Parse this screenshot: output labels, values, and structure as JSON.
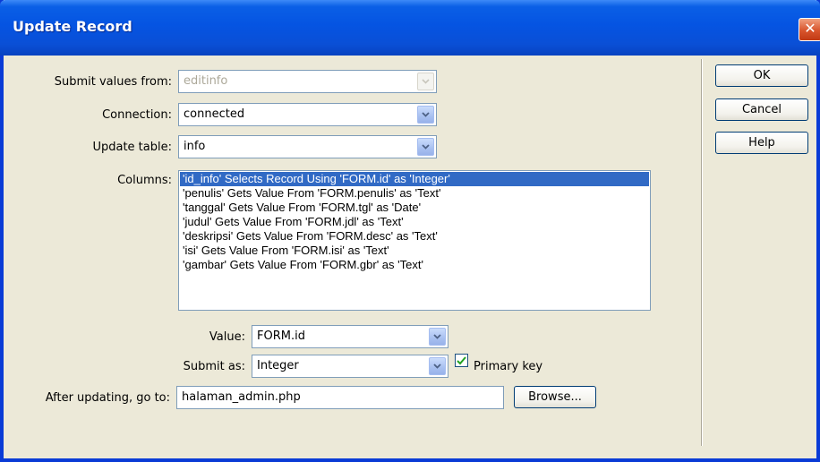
{
  "window": {
    "title": "Update Record",
    "close_glyph": "✕"
  },
  "form": {
    "submit_values_from": {
      "label": "Submit values from:",
      "value": "editinfo"
    },
    "connection": {
      "label": "Connection:",
      "value": "connected"
    },
    "update_table": {
      "label": "Update table:",
      "value": "info"
    },
    "columns": {
      "label": "Columns:",
      "items": [
        "'id_info' Selects Record Using 'FORM.id' as 'Integer'",
        "'penulis' Gets Value From 'FORM.penulis' as 'Text'",
        "'tanggal' Gets Value From 'FORM.tgl' as 'Date'",
        "'judul' Gets Value From 'FORM.jdl' as 'Text'",
        "'deskripsi' Gets Value From 'FORM.desc' as 'Text'",
        "'isi' Gets Value From 'FORM.isi' as 'Text'",
        "'gambar' Gets Value From 'FORM.gbr' as 'Text'"
      ],
      "selected_index": 0
    },
    "value": {
      "label": "Value:",
      "value": "FORM.id"
    },
    "submit_as": {
      "label": "Submit as:",
      "value": "Integer"
    },
    "primary_key": {
      "label": "Primary key",
      "checked": true
    },
    "after_updating": {
      "label": "After updating, go to:",
      "value": "halaman_admin.php"
    },
    "browse_label": "Browse..."
  },
  "buttons": {
    "ok": "OK",
    "cancel": "Cancel",
    "help": "Help"
  }
}
